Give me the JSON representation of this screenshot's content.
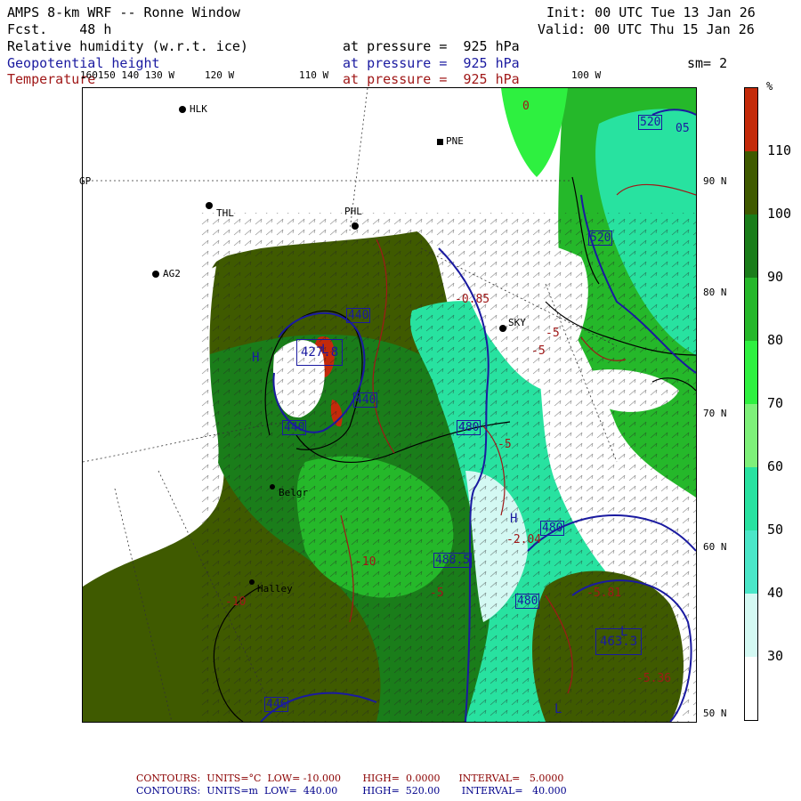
{
  "header": {
    "title": "AMPS 8-km WRF -- Ronne Window",
    "fcst": "Fcst.    48 h",
    "init": "Init: 00 UTC Tue 13 Jan 26",
    "valid": "Valid: 00 UTC Thu 15 Jan 26",
    "field1_name": "Relative humidity (w.r.t. ice)",
    "field1_level": "at pressure =  925 hPa",
    "field2_name": "Geopotential height",
    "field2_level": "at pressure =  925 hPa",
    "smoothing": "sm= 2",
    "field3_name": "Temperature",
    "field3_level": "at pressure =  925 hPa"
  },
  "lon_labels": [
    "160150 140 130 W",
    "120 W",
    "110 W",
    "100 W"
  ],
  "lat_labels": [
    "90 N",
    "80 N",
    "70 N",
    "60 N",
    "50 N"
  ],
  "stations": [
    {
      "name": "HLK"
    },
    {
      "name": "PNE"
    },
    {
      "name": "GP"
    },
    {
      "name": "THL"
    },
    {
      "name": "PHL"
    },
    {
      "name": "AG2"
    },
    {
      "name": "SKY"
    },
    {
      "name": "Belgr"
    },
    {
      "name": "Halley"
    }
  ],
  "height_labels": [
    "520",
    "520",
    "440",
    "427.8",
    "440",
    "440",
    "480",
    "480",
    "488.5",
    "480",
    "463.3",
    "446",
    "05"
  ],
  "temp_labels": [
    "0",
    "-5",
    "-0.85",
    "-2.04",
    "-5",
    "-10",
    "-5.36",
    "-5.81",
    "-5",
    "-10",
    "-5"
  ],
  "misc_labels": [
    "H",
    "L",
    "H",
    "L",
    "L"
  ],
  "colorbar": {
    "unit": "%",
    "ticks": [
      "110",
      "100",
      "90",
      "80",
      "70",
      "60",
      "50",
      "40",
      "30"
    ],
    "colors": [
      "#c42a0a",
      "#3f5a00",
      "#1a7d1a",
      "#25b82a",
      "#2ef040",
      "#7ef07a",
      "#28e2a0",
      "#4ae6c8",
      "#d4f9f3",
      "#ffffff"
    ]
  },
  "palette": {
    "rh_very_high": "#3f5a00",
    "rh_high": "#1a7d1a",
    "rh_mid": "#25b82a",
    "rh_bright": "#2ef040",
    "rh_cyan": "#28e2a0",
    "rh_pale": "#d4f9f3",
    "rh_max": "#c42a0a",
    "height_contour": "#1a1aa0",
    "temp_contour": "#a01818"
  },
  "footer": {
    "temp_contours": "CONTOURS:  UNITS=°C  LOW= -10.000       HIGH=  0.0000      INTERVAL=   5.0000",
    "height_contours": "CONTOURS:  UNITS=m  LOW=  440.00        HIGH=  520.00       INTERVAL=   40.000"
  }
}
